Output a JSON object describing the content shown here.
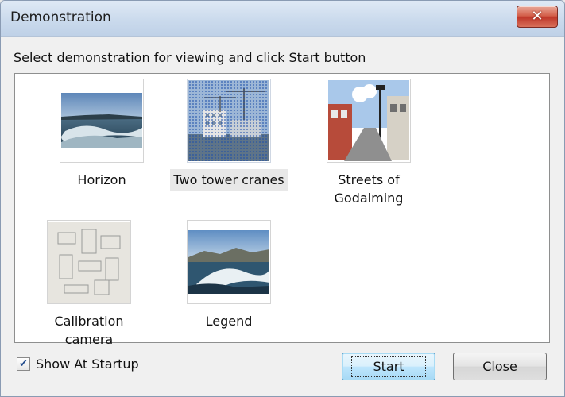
{
  "window": {
    "title": "Demonstration",
    "close_glyph": "✕"
  },
  "instruction": "Select demonstration for viewing and click Start button",
  "demos": [
    {
      "label": "Horizon",
      "icon": "horizon-thumbnail",
      "selected": false
    },
    {
      "label": "Two tower cranes",
      "icon": "tower-cranes-thumbnail",
      "selected": true
    },
    {
      "label_line1": "Streets of",
      "label_line2": "Godalming",
      "icon": "street-thumbnail",
      "selected": false
    },
    {
      "label": "Calibration camera",
      "icon": "calibration-thumbnail",
      "selected": false
    },
    {
      "label": "Legend",
      "icon": "legend-thumbnail",
      "selected": false
    }
  ],
  "footer": {
    "show_at_startup_label": "Show At Startup",
    "show_at_startup_checked": true,
    "check_glyph": "✔",
    "start_label": "Start",
    "close_label": "Close"
  },
  "colors": {
    "selection": "#1e50aa",
    "default_button_border": "#3c7fb1"
  }
}
